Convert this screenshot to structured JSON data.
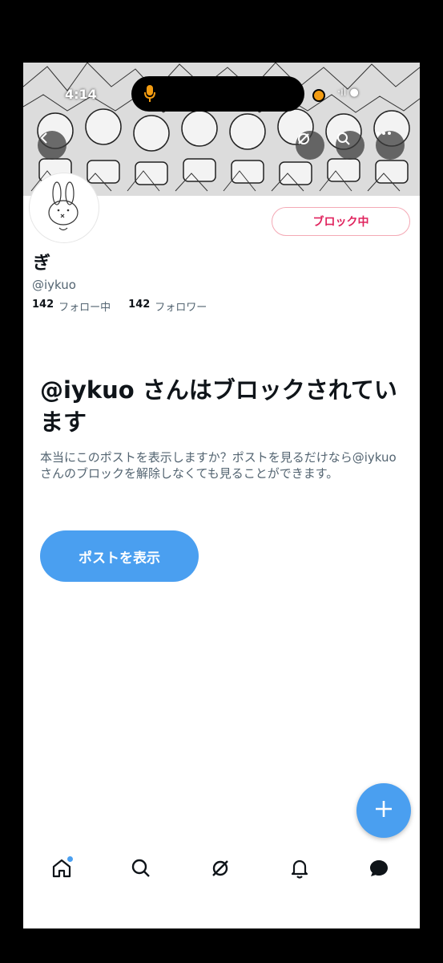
{
  "status_bar": {
    "time": "4:14",
    "right": "·ıl ●"
  },
  "profile": {
    "name": "ぎ",
    "handle": "@iykuo",
    "following_count": "142",
    "following_label": "フォロー中",
    "followers_count": "142",
    "followers_label": "フォロワー",
    "block_button_label": "ブロック中"
  },
  "blocked_notice": {
    "title": "@iykuo さんはブロックされています",
    "description": "本当にこのポストを表示しますか？ポストを見るだけなら@iykuo さんのブロックを解除しなくても見ることができます。",
    "show_button_label": "ポストを表示"
  },
  "colors": {
    "accent": "#4a9ff0",
    "blocked": "#e0245e",
    "text_primary": "#0f1419",
    "text_secondary": "#536471"
  },
  "icons": {
    "back": "arrow-left-icon",
    "grok": "grok-icon",
    "search": "search-icon",
    "more": "more-icon",
    "compose": "plus-icon",
    "tabs": [
      "home-icon",
      "search-icon",
      "grok-icon",
      "bell-icon",
      "chat-bubble-icon"
    ]
  }
}
